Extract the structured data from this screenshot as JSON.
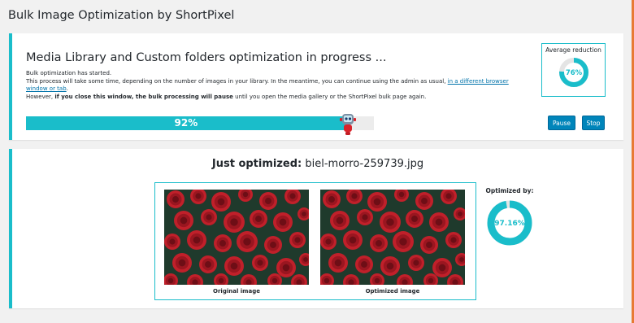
{
  "page_title": "Bulk Image Optimization by ShortPixel",
  "progress_panel": {
    "heading": "Media Library and Custom folders optimization in progress ...",
    "line1": "Bulk optimization has started.",
    "line2_text": "This process will take some time, depending on the number of images in your library. In the meantime, you can continue using the admin as usual, ",
    "line2_link": "in a different browser window or tab",
    "line2_end": ".",
    "line3_pre": "However, ",
    "line3_bold": "if you close this window, the bulk processing will pause",
    "line3_post": " until you open the media gallery or the ShortPixel bulk page again.",
    "progress_percent": 92,
    "progress_label": "92%",
    "avg_label": "Average reduction",
    "avg_value": "76%",
    "avg_fraction": 0.76,
    "pause_label": "Pause",
    "stop_label": "Stop"
  },
  "result_panel": {
    "just_label": "Just optimized:",
    "file_name": "biel-morro-259739.jpg",
    "original_caption": "Original image",
    "optimized_caption": "Optimized image",
    "optimized_by_label": "Optimized by:",
    "optimized_by_value": "97.16%",
    "optimized_by_fraction": 0.9716
  },
  "colors": {
    "accent": "#1abdca",
    "button": "#0085ba",
    "rose": "#c0202a",
    "leaves": "#1f3a2c"
  }
}
